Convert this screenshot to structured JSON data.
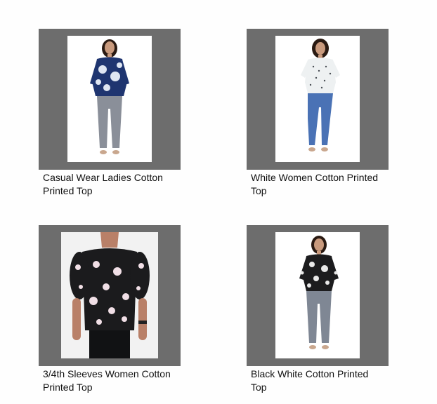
{
  "products": [
    {
      "name_line1": "Casual Wear Ladies Cotton",
      "name_line2": "Printed Top",
      "image": "woman-in-navy-floral-top-and-grey-jeans"
    },
    {
      "name_line1": "White Women Cotton Printed",
      "name_line2": "Top",
      "image": "woman-in-white-printed-top-and-blue-jeans"
    },
    {
      "name_line1": "3/4th Sleeves Women Cotton",
      "name_line2": "Printed Top",
      "image": "black-floral-puff-sleeve-top-closeup"
    },
    {
      "name_line1": "Black White Cotton Printed",
      "name_line2": "Top",
      "image": "woman-in-black-white-printed-top-and-grey-jeans"
    }
  ],
  "colors": {
    "frame": "#6d6d6d",
    "text": "#111111",
    "background": "#fefefe"
  }
}
